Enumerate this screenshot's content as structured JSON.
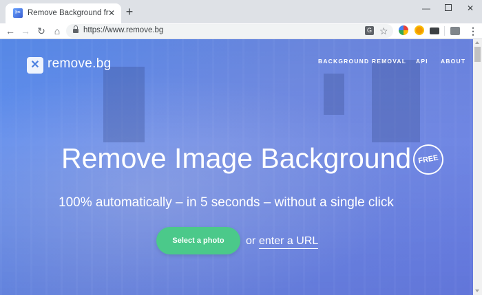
{
  "browser": {
    "tab_title": "Remove Background from Ima",
    "tab_close": "✕",
    "new_tab": "+",
    "url": "https://www.remove.bg",
    "window_controls": {
      "minimize": "—",
      "close": "✕"
    },
    "icons": [
      "back-icon",
      "forward-icon",
      "reload-icon",
      "home-icon",
      "lock-icon",
      "translate-icon",
      "star-icon",
      "extension-icons",
      "menu-icon"
    ]
  },
  "site": {
    "brand": "remove.bg",
    "nav": [
      "BACKGROUND REMOVAL",
      "API",
      "ABOUT"
    ],
    "headline": "Remove Image Background",
    "badge": "FREE",
    "subheadline": "100% automatically – in 5 seconds – without a single click",
    "cta": "Select a photo",
    "or_text": "or",
    "url_link": "enter a URL"
  },
  "colors": {
    "background_gradient": [
      "#5b8ff0",
      "#6a7fe6"
    ],
    "cta_green": "#4bc98a",
    "text": "#ffffff"
  }
}
